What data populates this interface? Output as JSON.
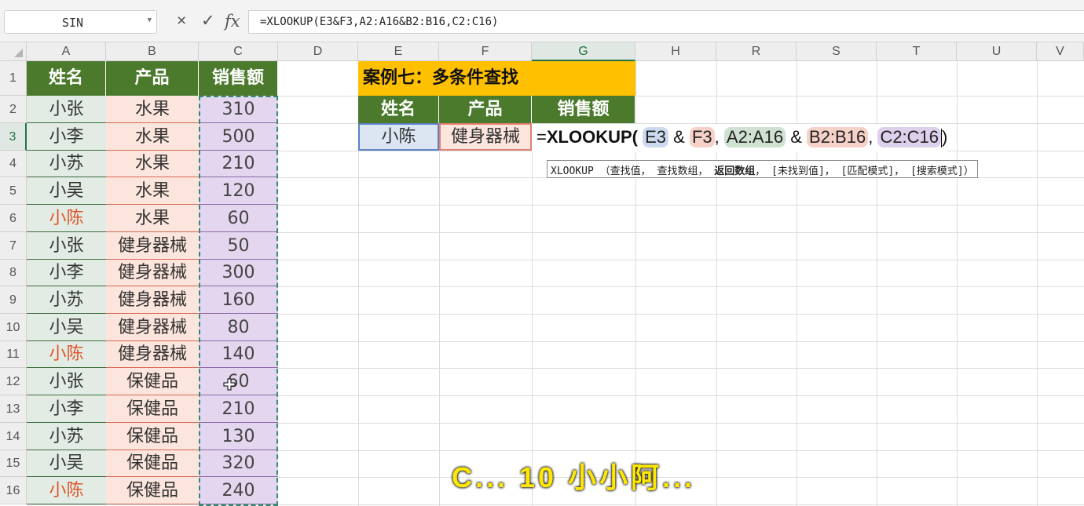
{
  "formula_bar": {
    "name_box": "SIN",
    "cancel_icon": "×",
    "confirm_icon": "✓",
    "fx_icon": "fx",
    "formula": "=XLOOKUP(E3&F3,A2:A16&B2:B16,C2:C16)"
  },
  "columns": [
    "A",
    "B",
    "C",
    "D",
    "E",
    "F",
    "G",
    "H",
    "R",
    "S",
    "T",
    "U",
    "V"
  ],
  "rows": [
    "1",
    "2",
    "3",
    "4",
    "5",
    "6",
    "7",
    "8",
    "9",
    "10",
    "11",
    "12",
    "13",
    "14",
    "15",
    "16"
  ],
  "table": {
    "headers": [
      "姓名",
      "产品",
      "销售额"
    ],
    "names": [
      "小张",
      "小李",
      "小苏",
      "小吴",
      "小陈",
      "小张",
      "小李",
      "小苏",
      "小吴",
      "小陈",
      "小张",
      "小李",
      "小苏",
      "小吴",
      "小陈"
    ],
    "products": [
      "水果",
      "水果",
      "水果",
      "水果",
      "水果",
      "健身器械",
      "健身器械",
      "健身器械",
      "健身器械",
      "健身器械",
      "保健品",
      "保健品",
      "保健品",
      "保健品",
      "保健品"
    ],
    "sales": [
      "310",
      "500",
      "210",
      "120",
      "60",
      "50",
      "300",
      "160",
      "80",
      "140",
      "60",
      "210",
      "130",
      "320",
      "240"
    ]
  },
  "case": {
    "title": "案例七：多条件查找",
    "headers": [
      "姓名",
      "产品",
      "销售额"
    ],
    "name_value": "小陈",
    "product_value": "健身器械"
  },
  "edit": {
    "prefix": "=",
    "function": "XLOOKUP(",
    "arg1": "E3",
    "amp1": "&",
    "arg2": "F3",
    "comma1": ",",
    "arg3": "A2:A16",
    "amp2": "&",
    "arg4": "B2:B16",
    "comma2": ",",
    "arg5": "C2:C16",
    "close": ")"
  },
  "tooltip": {
    "func": "XLOOKUP （查找值， 查找数组， ",
    "current": "返回数组",
    "rest": "， [未找到值]， [匹配模式]， [搜索模式]）"
  },
  "subtitle": "C... 10 小小阿..."
}
